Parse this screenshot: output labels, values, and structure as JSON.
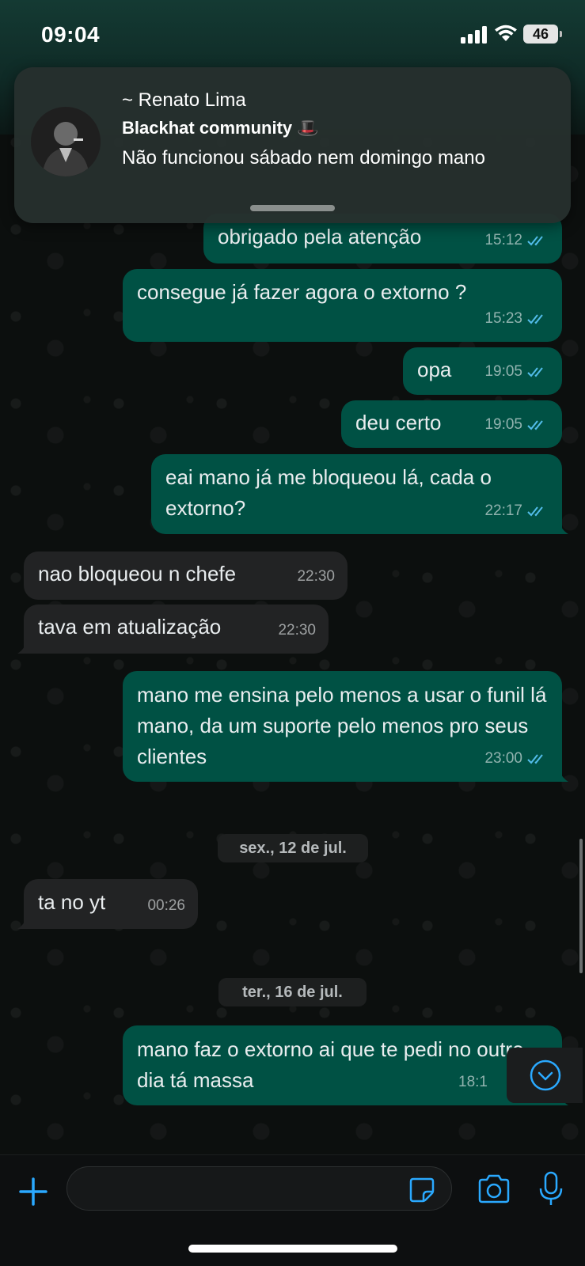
{
  "status_bar": {
    "time": "09:04",
    "battery": "46"
  },
  "notification": {
    "sender": "~ Renato Lima",
    "group": "Blackhat community 🎩",
    "message": "Não funcionou sábado nem domingo mano"
  },
  "messages": [
    {
      "direction": "out",
      "text": "obrigado pela atenção",
      "time": "15:12",
      "read": true
    },
    {
      "direction": "out",
      "text": "consegue já fazer agora o extorno ?",
      "time": "15:23",
      "read": true
    },
    {
      "direction": "out",
      "text": "opa",
      "time": "19:05",
      "read": true
    },
    {
      "direction": "out",
      "text": "deu certo",
      "time": "19:05",
      "read": true
    },
    {
      "direction": "out",
      "text": "eai mano já me bloqueou lá, cada o extorno?",
      "time": "22:17",
      "read": true
    },
    {
      "direction": "in",
      "text": "nao bloqueou n chefe",
      "time": "22:30"
    },
    {
      "direction": "in",
      "text": "tava em atualização",
      "time": "22:30"
    },
    {
      "direction": "out",
      "text": "mano me ensina pelo menos a usar o funil lá mano, da um suporte pelo menos pro seus clientes",
      "time": "23:00",
      "read": true
    },
    {
      "direction": "in",
      "text": "ta no yt",
      "time": "00:26"
    },
    {
      "direction": "out",
      "text": "mano faz o extorno ai que te pedi no outro dia tá massa",
      "time": "18:1"
    }
  ],
  "date_separators": [
    "sex., 12 de jul.",
    "ter., 16 de jul."
  ],
  "composer": {
    "placeholder": ""
  },
  "colors": {
    "outgoing_bubble": "#005144",
    "incoming_bubble": "#222324",
    "read_ticks": "#53bdeb",
    "accent": "#2aa9ff"
  },
  "icons": [
    "signal-icon",
    "wifi-icon",
    "plus-icon",
    "sticker-icon",
    "camera-icon",
    "mic-icon",
    "chevron-down-icon"
  ]
}
